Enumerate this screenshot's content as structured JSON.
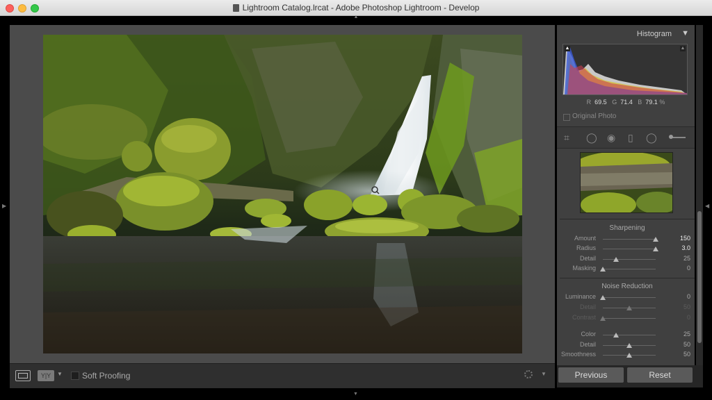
{
  "window": {
    "title": "Lightroom Catalog.lrcat - Adobe Photoshop Lightroom - Develop"
  },
  "toolbar": {
    "compare_label": "Y|Y",
    "soft_proofing_label": "Soft Proofing"
  },
  "histogram": {
    "title": "Histogram",
    "r_label": "R",
    "r_value": "69.5",
    "g_label": "G",
    "g_value": "71.4",
    "b_label": "B",
    "b_value": "79.1",
    "unit": "%",
    "original_photo_label": "Original Photo"
  },
  "sharpening": {
    "title": "Sharpening",
    "sliders": [
      {
        "label": "Amount",
        "value": "150",
        "position": 1.0
      },
      {
        "label": "Radius",
        "value": "3.0",
        "position": 1.0
      },
      {
        "label": "Detail",
        "value": "25",
        "position": 0.25
      },
      {
        "label": "Masking",
        "value": "0",
        "position": 0.0
      }
    ]
  },
  "noise_reduction": {
    "title": "Noise Reduction",
    "sliders": [
      {
        "label": "Luminance",
        "value": "0",
        "position": 0.0
      },
      {
        "label": "Detail",
        "value": "50",
        "position": 0.5
      },
      {
        "label": "Contrast",
        "value": "0",
        "position": 0.0
      },
      {
        "label": "Color",
        "value": "25",
        "position": 0.25
      },
      {
        "label": "Detail",
        "value": "50",
        "position": 0.5
      },
      {
        "label": "Smoothness",
        "value": "50",
        "position": 0.5
      }
    ]
  },
  "buttons": {
    "previous": "Previous",
    "reset": "Reset"
  }
}
